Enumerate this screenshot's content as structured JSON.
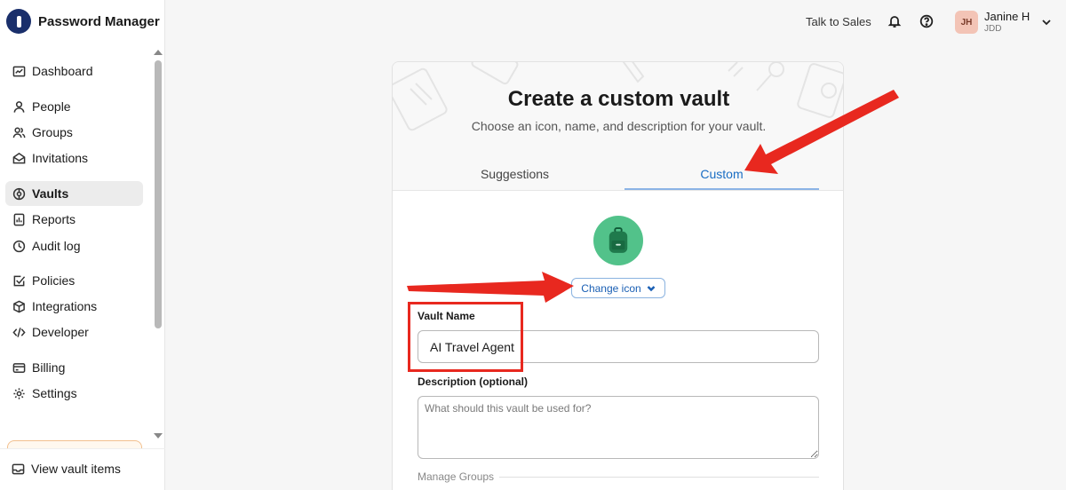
{
  "app": {
    "name": "Password Manager"
  },
  "sidebar": {
    "items": [
      {
        "label": "Dashboard",
        "icon": "dashboard-icon"
      },
      {
        "label": "People",
        "icon": "person-icon"
      },
      {
        "label": "Groups",
        "icon": "groups-icon"
      },
      {
        "label": "Invitations",
        "icon": "envelope-icon"
      },
      {
        "label": "Vaults",
        "icon": "vault-icon",
        "active": true
      },
      {
        "label": "Reports",
        "icon": "report-icon"
      },
      {
        "label": "Audit log",
        "icon": "clock-icon"
      },
      {
        "label": "Policies",
        "icon": "checkbox-icon"
      },
      {
        "label": "Integrations",
        "icon": "cube-icon"
      },
      {
        "label": "Developer",
        "icon": "code-icon"
      },
      {
        "label": "Billing",
        "icon": "credit-card-icon"
      },
      {
        "label": "Settings",
        "icon": "gear-icon"
      }
    ],
    "footer": {
      "label": "View vault items",
      "icon": "tray-icon"
    }
  },
  "topbar": {
    "sales_link": "Talk to Sales",
    "user": {
      "initials": "JH",
      "name": "Janine H",
      "org": "JDD"
    }
  },
  "modal": {
    "title": "Create a custom vault",
    "subtitle": "Choose an icon, name, and description for your vault.",
    "tabs": [
      {
        "label": "Suggestions",
        "active": false
      },
      {
        "label": "Custom",
        "active": true
      }
    ],
    "vault_icon": {
      "name": "backpack-icon",
      "color": "#52c28a"
    },
    "change_icon_label": "Change icon",
    "vault_name": {
      "label": "Vault Name",
      "value": "AI Travel Agent"
    },
    "description": {
      "label": "Description (optional)",
      "placeholder": "What should this vault be used for?"
    },
    "manage_groups_label": "Manage Groups"
  },
  "colors": {
    "accent": "#1a6ec4",
    "annotation": "#e8281f",
    "brand": "#1a2f6b"
  }
}
